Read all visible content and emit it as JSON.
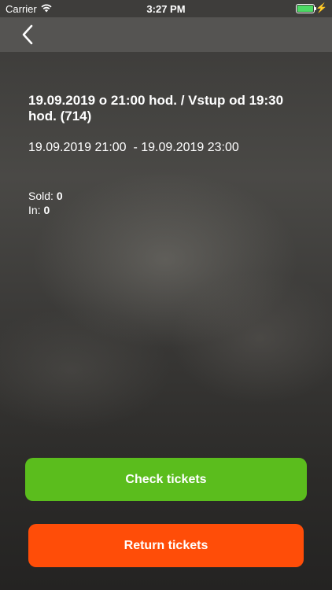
{
  "status_bar": {
    "carrier": "Carrier",
    "time": "3:27 PM",
    "battery_color": "#4cd964"
  },
  "nav": {
    "back_icon": "chevron-left-icon"
  },
  "event": {
    "title": "19.09.2019 o 21:00 hod. / Vstup od 19:30 hod. (714)",
    "range": "19.09.2019 21:00  - 19.09.2019 23:00"
  },
  "stats": {
    "sold_label": "Sold:",
    "sold_value": "0",
    "in_label": "In:",
    "in_value": "0"
  },
  "actions": {
    "check_label": "Check tickets",
    "check_color": "#5bbd1d",
    "return_label": "Return tickets",
    "return_color": "#ff4d08"
  }
}
